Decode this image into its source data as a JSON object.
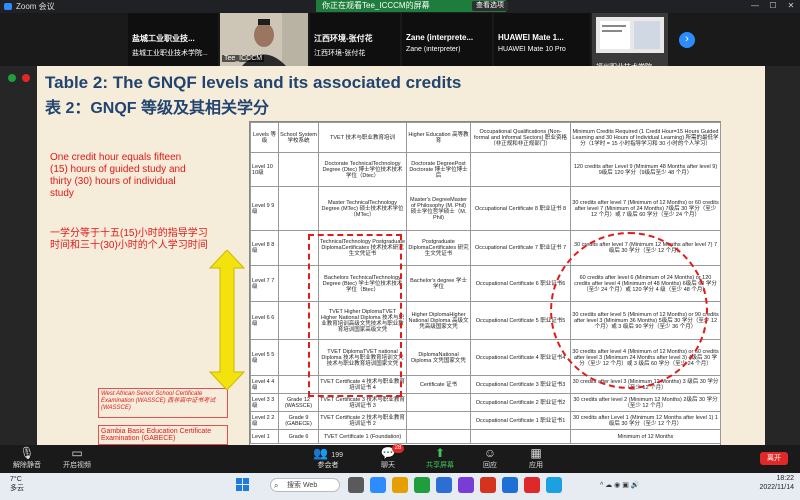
{
  "window": {
    "title": "Zoom 会议",
    "share_banner": "你正在观看Tee_ICCCM的屏幕",
    "view_options": "查看选项"
  },
  "participants": [
    {
      "name": "盐城工业职业技...",
      "sub": "盐城工业职业技术学院..."
    },
    {
      "name": "",
      "sub": "Tee_ICCCM"
    },
    {
      "name": "江西环境-张付花",
      "sub": "江西环境-张付花"
    },
    {
      "name": "Zane (interprete...",
      "sub": "Zane (interpreter)"
    },
    {
      "name": "HUAWEI Mate 1...",
      "sub": "HUAWEI Mate 10 Pro"
    },
    {
      "name": "",
      "sub": "福州职业技术学院..."
    }
  ],
  "slide": {
    "title_en": "Table 2: The GNQF levels and its associated credits",
    "title_cn": "表 2：GNQF 等级及其相关学分",
    "note_en": "One credit hour equals fifteen (15) hours of guided study and thirty (30) hours of individual study",
    "note_cn": "一学分等于十五(15)小时的指导学习时间和三十(30)小时的个人学习时间",
    "wassce": "West African Senior School Certificate Examination (WASSCE) 西非高中证书考试(WASSCE)",
    "gabece": "Gambia Basic Education Certificate Examination (GABECE)"
  },
  "table": {
    "headers": [
      "Levels 等级",
      "School System 学校系统",
      "TVET 技术与职业教育培训",
      "Higher Education 高等教育",
      "Occupational Qualifications (Non-formal and Informal Sectors) 职业资格（非正规和非正规部门）",
      "Minimum Credits Required (1 Credit Hour=15 Hours Guided Learning and 30 Hours of Individual Learning) 所需的最低学分（1学时 = 15 小时指导学习和 30 小时的个人学习）"
    ],
    "rows": [
      [
        "Level 10 10级",
        "",
        "Doctorate TechnicalTechnology Degree (Dtec) 博士学位技术技术学位（Dtec）",
        "Doctorate DegreePost Doctorate 博士学位博士后",
        "",
        "120 credits after Level 9 (Minimum 48 Months after level 9) 9级后 120 学分（9级后至少 48 个月）"
      ],
      [
        "Level 9 9级",
        "",
        "Master TechnicalTechnology Degree (MTec) 硕士技术技术学位（MTec）",
        "Master's DegreeMaster of Philosophy (M. Phil) 硕士学位哲学硕士（M. Phil)",
        "Occupational Certificate 8 职业证书 8",
        "30 credits after level 7 (Minimum of 12 Months) or 60 credits after level 7 (Minimum of 24 Months) 7级后 30 学分（至少 12 个月）或 7 级后 60 学分（至少 24 个月）"
      ],
      [
        "Level 8 8级",
        "",
        "TechnicalTechnology Postgraduate DiplomaCertificates 技术技术研究生文凭证书",
        "Postgraduate DiplomaCertificates 研究生文凭证书",
        "Occupational Certificate 7 职业证书 7",
        "30 credits after level 7 (Minimum 12 Months after level 7) 7级后 30 学分（至少 12 个月）"
      ],
      [
        "Level 7 7级",
        "",
        "Bachelors TechnicalTechnology Degree (Btec) 学士学位技术技术学位（Btec）",
        "Bachelor's degree 学士学位",
        "Occupational Certificate 6 职业证书6",
        "60 credits after level 6 (Minimum of 24 Months) or 120 credits after level 4 (Minimum of 48 Months) 6级后 60 学分（至少 24 个月）或 120 学分 4 级（至少 48 个月）"
      ],
      [
        "Level 6 6级",
        "",
        "TVET Higher DiplomaTVET Higher National Diploma 技术与职业教育培训高级文凭技术与职业教育培训国家高级文凭",
        "Higher DiplomaHigher National Diploma 高级文凭高级国家文凭",
        "Occupational Certificate 5 职业证书5",
        "30 credits after level 5 (Minimum of 12 Months) or 90 credits after level 3 (Minimum 36 Months) 5级后 30 学分（至少 12 个月）或 3 级后 90 学分（至少 36 个月）"
      ],
      [
        "Level 5 5级",
        "",
        "TVET DiplomaTVET national Diploma 技术与职业教育培训文凭技术与职业教育培训国家文凭",
        "DiplomaNational Diploma 文凭国家文凭",
        "Occupational Certificate 4 职业证书4",
        "30 credits after level 4 (Minimum of 12 Months) or 60 credits after level 3 (Minimum 24 Months after level 3) 4级后 30 学分（至少 12 个月）或 3 级后 60 学分（至少 24 个月）"
      ],
      [
        "Level 4 4级",
        "",
        "TVET Certificate 4 技术与职业教育培训证书 4",
        "Certificate 证书",
        "Occupational Certificate 3 职业证书3",
        "30 credits after level 3 (Minimum 12 Months) 3 级后 30 学分（至少 12 个月）"
      ],
      [
        "Level 3 3级",
        "Grade 12 (WASSCE)",
        "TVET Certificate 3 技术与职业教育培训证书 3",
        "",
        "Occupational Certificate 2 职业证书2",
        "30 credits after level 2 (Minimum 12 Months) 2级后 30 学分（至少 12 个月）"
      ],
      [
        "Level 2 2级",
        "Grade 9 (GABECE)",
        "TVET Certificate 2 技术与职业教育培训证书 2",
        "",
        "Occupational Certificate 1 职业证书1",
        "30 credits after Level 1 (Minimum 12 Months after level 1) 1级后 30 学分（至少 12 个月）"
      ],
      [
        "Level 1",
        "Grade 6",
        "TVET Certificate 1 (Foundation)",
        "",
        "",
        "Minimum of 12 Months"
      ]
    ]
  },
  "toolbar": {
    "unmute": "解除静音",
    "video": "开启视频",
    "participants": "参会者",
    "participants_count": "199",
    "chat": "聊天",
    "chat_badge": "28",
    "share": "共享屏幕",
    "reactions": "回应",
    "apps": "应用",
    "leave": "离开"
  },
  "taskbar": {
    "weather_temp": "7°C",
    "weather_text": "多云",
    "search": "搜索 Web",
    "time": "18:22",
    "date": "2022/11/14"
  },
  "colors": {
    "accent": "#2d8cff",
    "share_green": "#1e7d3c",
    "leave_red": "#e02828",
    "slide_title": "#214470",
    "annotation_red": "#e21b1b"
  }
}
